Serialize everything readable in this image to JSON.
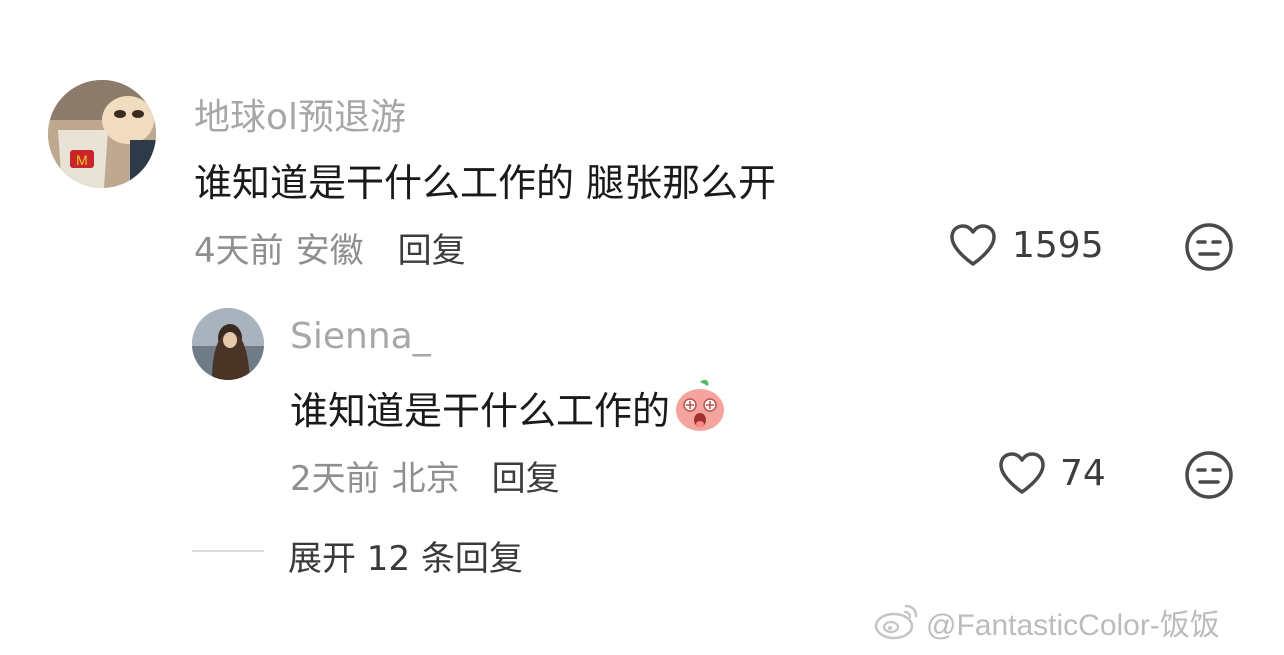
{
  "comment": {
    "username": "地球ol预退游",
    "text": "谁知道是干什么工作的 腿张那么开",
    "time": "4天前",
    "location": "安徽",
    "reply_label": "回复",
    "like_count": "1595"
  },
  "reply": {
    "username": "Sienna_",
    "text": "谁知道是干什么工作的",
    "time": "2天前",
    "location": "北京",
    "reply_label": "回复",
    "like_count": "74"
  },
  "expand_label": "展开 12 条回复",
  "watermark": "@FantasticColor-饭饭",
  "icons": [
    "heart-icon",
    "neutral-face-icon",
    "emoji-surprised-peach-icon",
    "weibo-logo-icon"
  ]
}
